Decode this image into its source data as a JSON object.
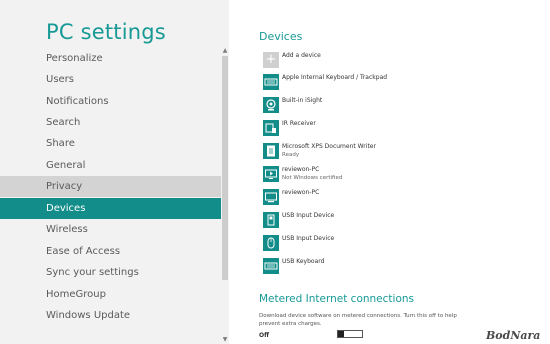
{
  "nav": {
    "title": "PC settings",
    "items": [
      {
        "label": "Personalize"
      },
      {
        "label": "Users"
      },
      {
        "label": "Notifications"
      },
      {
        "label": "Search"
      },
      {
        "label": "Share"
      },
      {
        "label": "General"
      },
      {
        "label": "Privacy"
      },
      {
        "label": "Devices"
      },
      {
        "label": "Wireless"
      },
      {
        "label": "Ease of Access"
      },
      {
        "label": "Sync your settings"
      },
      {
        "label": "HomeGroup"
      },
      {
        "label": "Windows Update"
      }
    ],
    "scroll_up_glyph": "▲",
    "scroll_down_glyph": "▼"
  },
  "devices": {
    "heading": "Devices",
    "items": [
      {
        "name": "Add a device",
        "sub": "",
        "icon": "plus-icon"
      },
      {
        "name": "Apple Internal Keyboard / Trackpad",
        "sub": "",
        "icon": "keyboard-icon"
      },
      {
        "name": "Built-in iSight",
        "sub": "",
        "icon": "webcam-icon"
      },
      {
        "name": "IR Receiver",
        "sub": "",
        "icon": "ir-receiver-icon"
      },
      {
        "name": "Microsoft XPS Document Writer",
        "sub": "Ready",
        "icon": "printer-icon"
      },
      {
        "name": "reviewon-PC",
        "sub": "Not Windows certified",
        "icon": "media-device-icon"
      },
      {
        "name": "reviewon-PC",
        "sub": "",
        "icon": "pc-icon"
      },
      {
        "name": "USB Input Device",
        "sub": "",
        "icon": "usb-device-icon"
      },
      {
        "name": "USB Input Device",
        "sub": "",
        "icon": "mouse-icon"
      },
      {
        "name": "USB Keyboard",
        "sub": "",
        "icon": "keyboard-icon"
      }
    ]
  },
  "metered": {
    "heading": "Metered Internet connections",
    "description": "Download device software on metered connections. Turn this off to help prevent extra charges.",
    "state": "Off"
  },
  "watermark": "BodNara",
  "colors": {
    "accent": "#179a96",
    "selected": "#138d89",
    "nav_bg": "#f2f2f2",
    "hover": "#d3d3d3"
  }
}
